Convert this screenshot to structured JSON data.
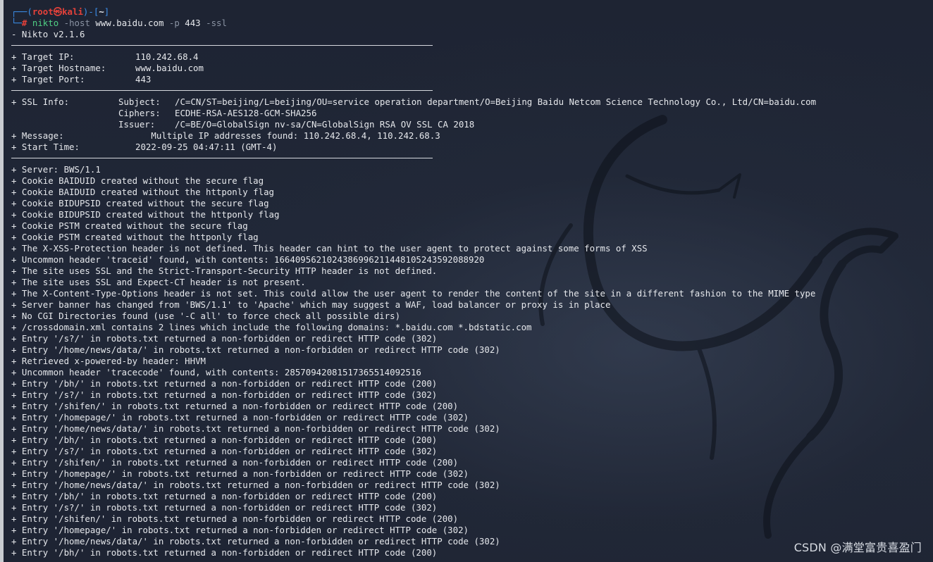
{
  "prompt": {
    "user": "root",
    "at_symbol": "㉿",
    "host": "kali",
    "dir": "~",
    "symbol": "#",
    "command": "nikto",
    "host_flag": "-host",
    "host_value": "www.baidu.com",
    "port_flag": "-p",
    "port_value": "443",
    "ssl_flag": "-ssl"
  },
  "version_line": "- Nikto v2.1.6",
  "target": [
    {
      "key": "+ Target IP:",
      "value": "110.242.68.4"
    },
    {
      "key": "+ Target Hostname:",
      "value": "www.baidu.com"
    },
    {
      "key": "+ Target Port:",
      "value": "443"
    }
  ],
  "ssl": {
    "key": "+ SSL Info:",
    "subject_key": "Subject:",
    "subject_value": "/C=CN/ST=beijing/L=beijing/OU=service operation department/O=Beijing Baidu Netcom Science Technology Co., Ltd/CN=baidu.com",
    "ciphers_key": "Ciphers:",
    "ciphers_value": "ECDHE-RSA-AES128-GCM-SHA256",
    "issuer_key": "Issuer:",
    "issuer_value": "/C=BE/O=GlobalSign nv-sa/CN=GlobalSign RSA OV SSL CA 2018"
  },
  "message": {
    "key": "+ Message:",
    "value": "   Multiple IP addresses found: 110.242.68.4, 110.242.68.3"
  },
  "start_time": {
    "key": "+ Start Time:",
    "value": "2022-09-25 04:47:11 (GMT-4)"
  },
  "results": [
    "+ Server: BWS/1.1",
    "+ Cookie BAIDUID created without the secure flag",
    "+ Cookie BAIDUID created without the httponly flag",
    "+ Cookie BIDUPSID created without the secure flag",
    "+ Cookie BIDUPSID created without the httponly flag",
    "+ Cookie PSTM created without the secure flag",
    "+ Cookie PSTM created without the httponly flag",
    "+ The X-XSS-Protection header is not defined. This header can hint to the user agent to protect against some forms of XSS",
    "+ Uncommon header 'traceid' found, with contents: 1664095621024386996211448105243592088920",
    "+ The site uses SSL and the Strict-Transport-Security HTTP header is not defined.",
    "+ The site uses SSL and Expect-CT header is not present.",
    "+ The X-Content-Type-Options header is not set. This could allow the user agent to render the content of the site in a different fashion to the MIME type",
    "+ Server banner has changed from 'BWS/1.1' to 'Apache' which may suggest a WAF, load balancer or proxy is in place",
    "+ No CGI Directories found (use '-C all' to force check all possible dirs)",
    "+ /crossdomain.xml contains 2 lines which include the following domains: *.baidu.com *.bdstatic.com",
    "+ Entry '/s?/' in robots.txt returned a non-forbidden or redirect HTTP code (302)",
    "+ Entry '/home/news/data/' in robots.txt returned a non-forbidden or redirect HTTP code (302)",
    "+ Retrieved x-powered-by header: HHVM",
    "+ Uncommon header 'tracecode' found, with contents: 28570942081517365514092516",
    "+ Entry '/bh/' in robots.txt returned a non-forbidden or redirect HTTP code (200)",
    "+ Entry '/s?/' in robots.txt returned a non-forbidden or redirect HTTP code (302)",
    "+ Entry '/shifen/' in robots.txt returned a non-forbidden or redirect HTTP code (200)",
    "+ Entry '/homepage/' in robots.txt returned a non-forbidden or redirect HTTP code (302)",
    "+ Entry '/home/news/data/' in robots.txt returned a non-forbidden or redirect HTTP code (302)",
    "+ Entry '/bh/' in robots.txt returned a non-forbidden or redirect HTTP code (200)",
    "+ Entry '/s?/' in robots.txt returned a non-forbidden or redirect HTTP code (302)",
    "+ Entry '/shifen/' in robots.txt returned a non-forbidden or redirect HTTP code (200)",
    "+ Entry '/homepage/' in robots.txt returned a non-forbidden or redirect HTTP code (302)",
    "+ Entry '/home/news/data/' in robots.txt returned a non-forbidden or redirect HTTP code (302)",
    "+ Entry '/bh/' in robots.txt returned a non-forbidden or redirect HTTP code (200)",
    "+ Entry '/s?/' in robots.txt returned a non-forbidden or redirect HTTP code (302)",
    "+ Entry '/shifen/' in robots.txt returned a non-forbidden or redirect HTTP code (200)",
    "+ Entry '/homepage/' in robots.txt returned a non-forbidden or redirect HTTP code (302)",
    "+ Entry '/home/news/data/' in robots.txt returned a non-forbidden or redirect HTTP code (302)",
    "+ Entry '/bh/' in robots.txt returned a non-forbidden or redirect HTTP code (200)"
  ],
  "watermark": "CSDN @满堂富贵喜盈门",
  "icons": {
    "background": "kali-dragon-icon"
  }
}
